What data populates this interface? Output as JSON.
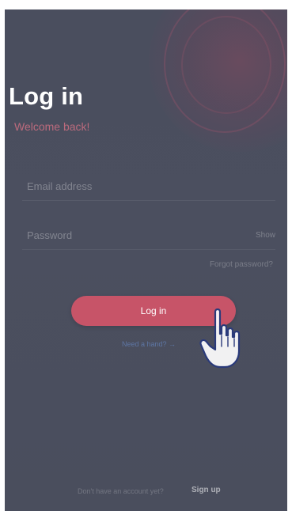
{
  "login": {
    "title": "Log in",
    "subtitle": "Welcome back!",
    "email_placeholder": "Email address",
    "password_placeholder": "Password",
    "show_label": "Show",
    "forgot_label": "Forgot password?",
    "button_label": "Log in",
    "alt_link": "Need a hand? →"
  },
  "footer": {
    "prompt": "Don't have an account yet?",
    "signup_label": "Sign up"
  },
  "cursor": {
    "icon": "hand-pointer-icon"
  },
  "colors": {
    "background": "#4a4e5e",
    "accent": "#c75468",
    "subtitle": "#cf6f82"
  }
}
